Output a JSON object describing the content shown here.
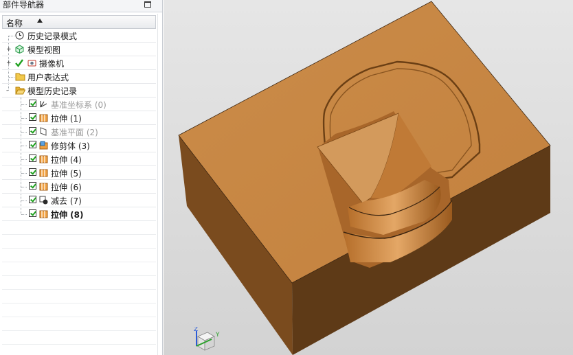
{
  "navigator": {
    "title": "部件导航器",
    "column_header": "名称",
    "rows": [
      {
        "label": "历史记录模式",
        "icon": "clock-icon",
        "expand": "",
        "checked": false,
        "state": "normal"
      },
      {
        "label": "模型视图",
        "icon": "model-view-icon",
        "expand": "+",
        "checked": false,
        "state": "normal"
      },
      {
        "label": "摄像机",
        "icon": "camera-icon",
        "expand": "+",
        "checked": true,
        "state": "normal"
      },
      {
        "label": "用户表达式",
        "icon": "folder-icon",
        "expand": "",
        "checked": false,
        "state": "normal"
      },
      {
        "label": "模型历史记录",
        "icon": "folder-open-icon",
        "expand": "-",
        "checked": false,
        "state": "normal"
      },
      {
        "label": "基准坐标系 (0)",
        "icon": "datum-csys-icon",
        "checked": true,
        "state": "gray"
      },
      {
        "label": "拉伸 (1)",
        "icon": "extrude-icon",
        "checked": true,
        "state": "normal"
      },
      {
        "label": "基准平面 (2)",
        "icon": "datum-plane-icon",
        "checked": true,
        "state": "gray"
      },
      {
        "label": "修剪体 (3)",
        "icon": "trim-body-icon",
        "checked": true,
        "state": "normal"
      },
      {
        "label": "拉伸 (4)",
        "icon": "extrude-icon",
        "checked": true,
        "state": "normal"
      },
      {
        "label": "拉伸 (5)",
        "icon": "extrude-icon",
        "checked": true,
        "state": "normal"
      },
      {
        "label": "拉伸 (6)",
        "icon": "extrude-icon",
        "checked": true,
        "state": "normal"
      },
      {
        "label": "减去 (7)",
        "icon": "subtract-icon",
        "checked": true,
        "state": "normal"
      },
      {
        "label": "拉伸 (8)",
        "icon": "extrude-icon",
        "checked": true,
        "state": "bold"
      }
    ]
  },
  "triad": {
    "z": "Z",
    "y": "Y"
  },
  "colors": {
    "model_top": "#C98A47",
    "model_front": "#5E3A17",
    "model_side": "#7A4B1E",
    "viewport_bg": "#DCDCDC"
  }
}
